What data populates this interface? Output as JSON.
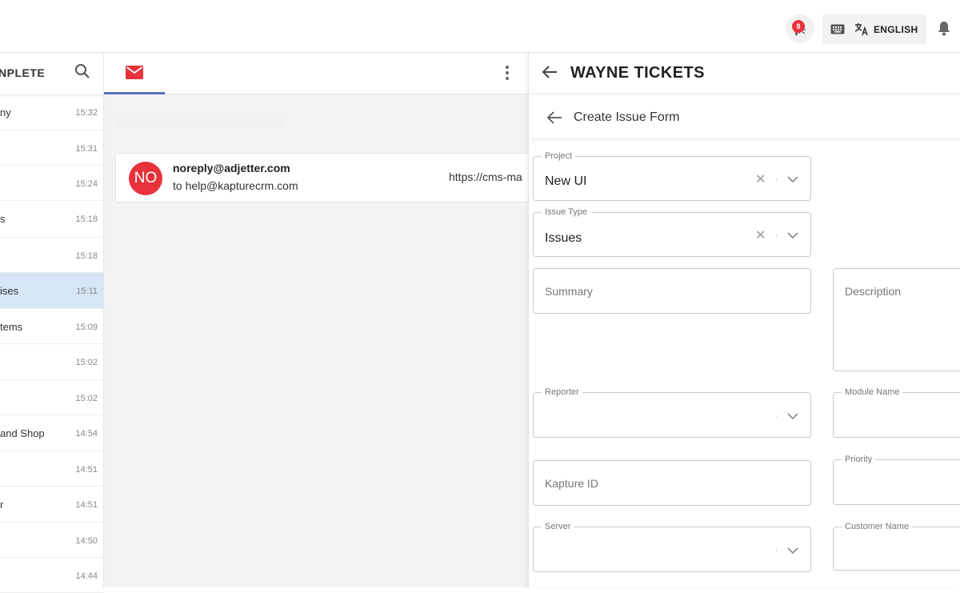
{
  "topbar": {
    "notification_count": "8",
    "language": "ENGLISH"
  },
  "left_panel": {
    "header_title": "NPLETE",
    "items": [
      {
        "name": "ny",
        "time": "15:32"
      },
      {
        "name": "",
        "time": "15:31"
      },
      {
        "name": "",
        "time": "15:24"
      },
      {
        "name": "s",
        "time": "15:18"
      },
      {
        "name": "",
        "time": "15:18"
      },
      {
        "name": "ises",
        "time": "15:11",
        "active": true
      },
      {
        "name": "tems",
        "time": "15:09"
      },
      {
        "name": "",
        "time": "15:02"
      },
      {
        "name": "",
        "time": "15:02"
      },
      {
        "name": "and Shop",
        "time": "14:54"
      },
      {
        "name": "",
        "time": "14:51"
      },
      {
        "name": "r",
        "time": "14:51"
      },
      {
        "name": "",
        "time": "14:50"
      },
      {
        "name": "",
        "time": "14:44"
      }
    ]
  },
  "mail": {
    "avatar_initials": "NO",
    "from": "noreply@adjetter.com",
    "to": "to help@kapturecrm.com",
    "url_preview": "https://cms-ma"
  },
  "right_panel": {
    "title": "WAYNE TICKETS",
    "subtitle": "Create Issue Form",
    "fields": {
      "project": {
        "label": "Project",
        "value": "New UI"
      },
      "issue_type": {
        "label": "Issue Type",
        "value": "Issues"
      },
      "summary": {
        "placeholder": "Summary"
      },
      "description": {
        "placeholder": "Description"
      },
      "reporter": {
        "label": "Reporter"
      },
      "module_name": {
        "label": "Module Name"
      },
      "kapture_id": {
        "placeholder": "Kapture ID"
      },
      "priority": {
        "label": "Priority"
      },
      "server": {
        "label": "Server"
      },
      "customer_name": {
        "label": "Customer Name"
      }
    }
  },
  "colors": {
    "accent_red": "#e8323c",
    "tab_underline": "#5a6fb8",
    "active_row": "#d6e6f5"
  }
}
